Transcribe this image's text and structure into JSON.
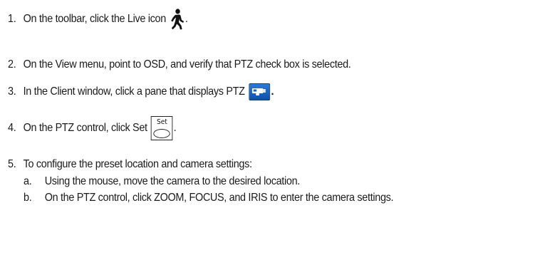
{
  "steps": [
    {
      "number": "1.",
      "text": "On the toolbar, click the Live icon",
      "icon": "live-walking-person-icon",
      "suffix": "."
    },
    {
      "number": "2.",
      "text": "On the View menu, point to OSD, and verify that PTZ check box is selected."
    },
    {
      "number": "3.",
      "text": "In the Client window, click a pane that displays PTZ",
      "icon": "ptz-camera-icon",
      "suffix": "."
    },
    {
      "number": "4.",
      "text": "On the PTZ control, click Set",
      "icon": "set-button-icon",
      "icon_label": "Set",
      "suffix": "."
    },
    {
      "number": "5.",
      "text": "To configure the preset location and camera settings:",
      "substeps": [
        {
          "letter": "a.",
          "text": "Using the mouse, move the camera to the desired location."
        },
        {
          "letter": "b.",
          "text": "On the PTZ control, click ZOOM, FOCUS, and IRIS to enter the camera settings."
        }
      ]
    }
  ],
  "colors": {
    "text": "#1a1a1a",
    "ptz_icon_blue": "#1464c0"
  }
}
